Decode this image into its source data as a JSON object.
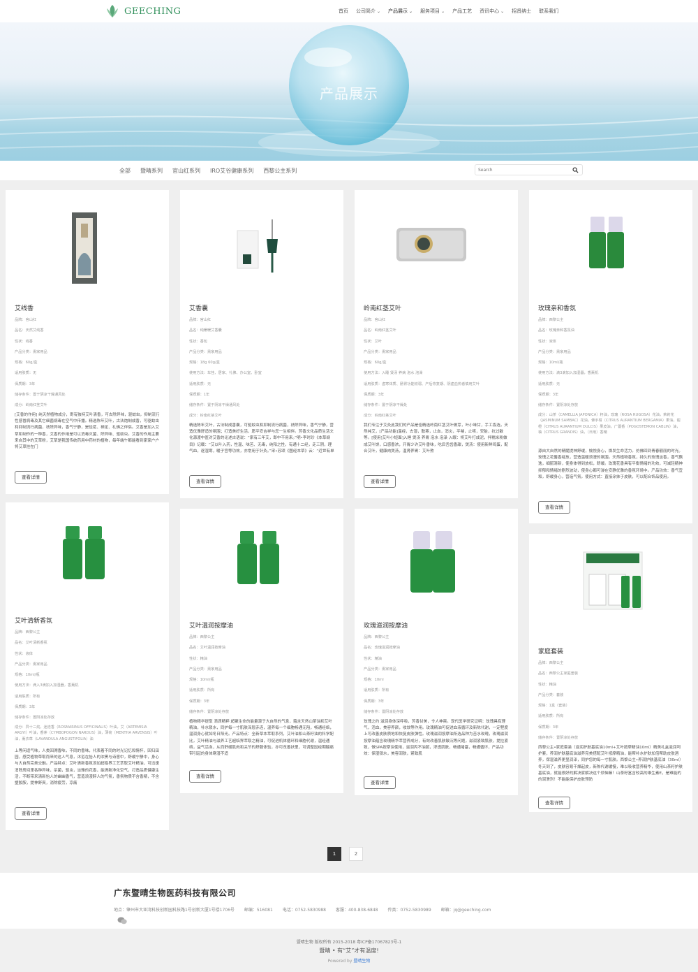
{
  "brand": {
    "name": "GEECHING",
    "color": "#2f8f5a"
  },
  "nav": [
    {
      "label": "首页",
      "caret": false
    },
    {
      "label": "公司简介",
      "caret": true
    },
    {
      "label": "产品展示",
      "caret": true
    },
    {
      "label": "服务项目",
      "caret": true
    },
    {
      "label": "产品工艺",
      "caret": false
    },
    {
      "label": "资讯中心",
      "caret": true
    },
    {
      "label": "招贤纳士",
      "caret": false
    },
    {
      "label": "联系我们",
      "caret": false
    }
  ],
  "banner": {
    "title": "产品展示"
  },
  "filters": [
    "全部",
    "暨晴系列",
    "官山红系列",
    "IRO艾谷健康系列",
    "西黎公主系列"
  ],
  "search": {
    "placeholder": "Search"
  },
  "products": [
    {
      "title": "艾线香",
      "specs": [
        "品牌：官山红",
        "品名：天然艾线香",
        "性状：线香",
        "产品分类：熏家用品",
        "规格：60g/盒",
        "适用肤质：无",
        "保质期：3年",
        "储存条件：置于阴凉干燥通风处",
        "成分：岭南红茎艾叶"
      ],
      "desc": "[艾香的作用] 纯天然植物成分，寄有独特艾叶清香，可去除异味，驱蚊虫，抑制流行性感冒病毒及其它细菌病毒在空气中传播。精选陈年艾叶，古法炮制成香，可驱蚊虫和抑制流行病菌，祛除异味，香气宁静，是佳茗、禅定、礼佛之伴侣。艾香是加入艾草和制作的一种香，艾香的作用是可以消毒灭菌、除异味、驱蚊虫。艾香的作用主要来自其中的艾草粉，艾草是我国传统药用中药材的植物，每年端午都能看到家家户户将艾草挂在门",
      "button": "查看详情"
    },
    {
      "title": "艾香囊",
      "specs": [
        "品牌：官山红",
        "品名：纯暖暖艾香囊",
        "性状：香包",
        "产品分类：熏家用品",
        "规格：18g 60g/盒",
        "使用方法：车挂、居家、礼佛、办公室、卧室",
        "适用肤质：无",
        "保质期：1年",
        "储存条件：置于阴凉干燥通风处",
        "成分：岭南红茎艾叶"
      ],
      "desc": "精选陈年艾叶，古法制成香囊，可驱蚊虫和抑制流行病菌，祛除异味，香气宁静，营造优雅舒适的氛围；打造美好生活，愿平安吉祥与您一生相伴。芳香文化品质生活文化源渡中医对艾香的论述古语说：“家有三年艾，郎中不用来。”明•李时珍《本草纲目》记载：“艾以叶入药，性温、味苦、无毒，纯阳之性，有通十二经，走三阴，理气血，逐湿寒，暖子宫等功效，亦常用于针灸。”宋•苏颂《图经本草》云：“近世有单",
      "button": "查看详情"
    },
    {
      "title": "岭南红茎艾叶",
      "specs": [
        "品牌：官山红",
        "品名：岭南红茎艾叶",
        "性状：艾叶",
        "产品分类：熏家用品",
        "规格：60g/盒",
        "使用方法：入睡 煲汤 养病 泡水 泡澡",
        "适用肤质：虚寒体质、肠胃功能较弱、产后恢复期、阴虚血热者慎用艾叶",
        "保质期：3年",
        "储存条件：置于阴凉干燥处",
        "成分：岭南红茎艾叶"
      ],
      "desc": "我们专注于艾灸此我们的产品是佳精选岭南红茎艾叶做芽，叶小味甘，手工拣选，天然纯艾，[产品功能]温经，去湿，散寒，止血，消炎，平喘，止咳，安胎，抗过敏等。[使用]艾叶小短面]入睡 煲汤 养胃 泡水 泡澡 入眠：将艾叶打成泥，拌糯米粉做成艾叶饼，口感香浓，开胃少许艾叶香味，吃后舌齿香甜，煲汤：使用新鲜鸡蛋，配合艾叶，健康肉煲汤，温肾养胃：艾叶熬",
      "button": "查看详情"
    },
    {
      "title": "玫瑰亲和香氛",
      "specs": [
        "品牌：西黎公主",
        "品名：玫瑰亲和香氛油",
        "性状：液体",
        "产品分类：熏家用品",
        "规格：10ml/瓶",
        "使用方法：滴3滴加入加湿器，香薰机",
        "适用肤质：无",
        "保质期：3年",
        "储存条件：置阴凉处存放"
      ],
      "specsWrap": "成分：山茶（CAMELLIA JAPONICA）籽油，玫瑰（ROSA RUGOSA）花油，茉莉花（JASMINUM SAMBAC）花油，佛手柑（CITRUS AURANTIUM BERGAMIA）果油，甜橙（CITRUS AURANTIUM DULCIS）果皮油，广藿香（POGOSTEMON CABLIN）油，柚（CITRUS GRANDIS）油，（日用）香精",
      "desc": "源自大自然的精髓提神舒缓，愉悦身心，焕发生命活力。仿佛回到青春靓丽的时光。玫瑰之花馨香绽放，营造温暖浪漫的氛围。天然植物香氛，持久的玫瑰淡香，香气飘逸，细腻清新，使身体得到放松，舒缓。玫瑰花香具有平衡情绪的功效，可减轻精神抑郁和情绪的剧烈波动，使身心都可浸在安静优雅的香氛环境中。产品功效：香气宜和，舒缓身心，营造气氛。使用方式：直接涂抹于皮肤，可以配合饰品使用。",
      "button": "查看详情"
    },
    {
      "title": "艾叶清新香氛",
      "specs": [
        "品牌：西黎公主",
        "品名：艾叶清新香氛",
        "性状：液体",
        "产品分类：熏家用品",
        "规格：10ml/瓶",
        "使用方法：滴入3滴加入加湿器，香薰机",
        "适用肤质：所有",
        "保质期：3年",
        "储存条件：置阴凉处存放"
      ],
      "specsWrap": "成分：异十二烷，迷迭香（ROSMARINUS OFFICINALIS）叶油，艾（ARTEMISIA ARGYI）叶油，香茅（CYMBOPOGON NARDUS）油，薄荷（MENTHA ARVENSIS）叶油，薰衣草（LAVANDULA ANGUSTIFOLIA）油",
      "desc": "上等闲适气味，人类回溯香味，不同的香味，代表着不同的时光记忆和情怀，回归田园，感受植物草取而来的这人气息，沐浴在怡人的浓黑与诗意中，舒缓宁静中，身心与大自然完美交融。产品特点：艾叶清新香氛添加超临界工艺萃取艾叶精油，可迅速消除房间里各种异味，杀菌，驱虫，淡雅的花香，能清新净化空气，打造品质健康生活，不断带来清新怡人的幽幽香气，营造浪漫醉人的气氛，香氛物质不含香精，不含塑胶胺，提神舒爽，消除疲劳，凉痛",
      "button": "查看详情"
    },
    {
      "title": "艾叶温润按摩油",
      "specs": [
        "品牌：西黎公主",
        "品名：艾叶温润按摩油",
        "性状：精油",
        "产品分类：熏家用品",
        "规格：10ml/瓶",
        "适用肤质：所有",
        "保质期：3年",
        "储存条件：置阴凉处存放"
      ],
      "desc": "植物精华提取 滴滴精粹 超聚生命的能量源于大自然的气息，蕴含天然山茶油和艾叶精油，补水锁水，同护每一寸肌肤深层赤连，温养每一个细胞畅通无阻，畅通经络，温润身心就如冬日阳光。产品特点：全新草本萃取系列，艾叶油和山茶籽油的科学配比，艾叶精油与滋养工艺超临界萃取之精油，可促进机体循环和细胞代谢，温经通络，益气活血，从而舒缓肌肉和关节的舒服体验，亦可改善扶里，可调整因经期酸痛带引起的身体寒湿不适",
      "button": "查看详情"
    },
    {
      "title": "玫瑰滋润按摩油",
      "specs": [
        "品牌：西黎公主",
        "品名：玫瑰滋润按摩油",
        "性状：精油",
        "产品分类：熏家用品",
        "规格：10ml",
        "适用肤质：所有",
        "保质期：3年",
        "储存条件：置阴凉处存放"
      ],
      "desc": "玫瑰之约 滋润身体深呼吸，芳香甘美，令人神爽。现代医学研究证明：玫瑰具有理气，活血，美容养颜，收敛等作用。玫瑰精油可促进血液循环及新陈代谢，一定程度上可改善皮肤质地和恢复皮肤弹性。玫瑰滋润按摩油所选品种为苦水玫瑰，玫瑰滋润按摩油蕴含玫瑰精华萃营养成分，有效改善肌肤敏沉等问题，滋润紧致肌肤，提拉紧致，做SPA按摩油使用，滋润丙不油腻，渗透肌肤，畅通堵塞，畅通循环，产品功效：保湿锁水，美容润肤，紧致肌",
      "button": "查看详情"
    },
    {
      "title": "家庭套装",
      "specs": [
        "品牌：西黎公主",
        "品名：西黎公主家庭套装",
        "性状：精油",
        "产品分类：套装",
        "规格：1盒（套装）",
        "适用肤质：所有",
        "保质期：3年",
        "储存条件：置阴凉处存放"
      ],
      "desc": "西黎公主•家庭套装（滋润护肤基底油10ml+艾叶按摩精油10ml）精美礼盒滋润呵护套，养润护肤基底油滋养完美搭配艾叶按摩精油，能帮补水护肤加倍帮助皮肤酒养，保湿滋养更显润泽，同护您的每一寸肌肤。西黎公主•养润护肤基底油（30ml）冬天到了，皮肤容易干燥起皮，新陈代谢缓慢，难以吸收营养精华，使用山茶籽护肤基底油，就能很好的解决家解决这个烦恼嘛！山茶籽富含较高的维生素E，是难能的的润滑剂！不能能保护皮肤预防",
      "button": "查看详情"
    }
  ],
  "pagination": {
    "current": "1",
    "next": "2"
  },
  "footer": {
    "company": "广东暨晴生物医药科技有限公司",
    "contacts": [
      "地点：肇州市大亚湾科技创新园科技路1号创新大厦1号楼1706号",
      "邮编：516081",
      "电话：0752-5830988",
      "客服：400-838-6848",
      "传真：0752-5830989",
      "邮箱：jq@geeching.com"
    ],
    "copyright": "暨晴生物 版权所有 2015-2018 粤ICP备17067823号-1",
    "slogan": "暨晴 • 有“艾”才有温度!",
    "powered_prefix": "Powered by ",
    "powered_brand": "暨晴生物"
  }
}
